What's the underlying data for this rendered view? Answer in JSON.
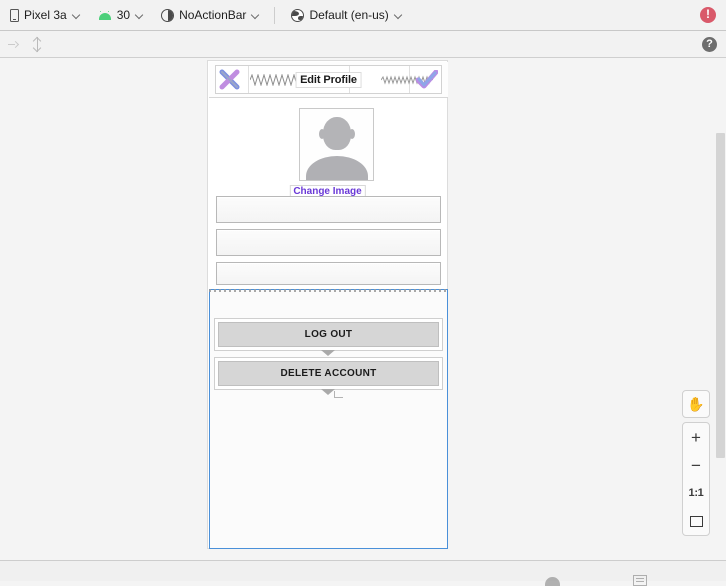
{
  "config_toolbar": {
    "device": {
      "icon": "phone-icon",
      "label": "Pixel 3a"
    },
    "api": {
      "icon": "android-icon",
      "label": "30"
    },
    "theme": {
      "icon": "theme-icon",
      "label": "NoActionBar"
    },
    "locale": {
      "icon": "globe-icon",
      "label": "Default (en-us)"
    },
    "error_badge": {
      "icon": "error-icon",
      "symbol": "!",
      "color": "#d9596a"
    }
  },
  "tool_toolbar": {
    "buttons": [
      {
        "icon": "arrow-right-icon",
        "enabled": false
      },
      {
        "icon": "vertical-resize-icon",
        "enabled": false
      }
    ],
    "help": {
      "icon": "help-icon",
      "symbol": "?"
    }
  },
  "preview": {
    "appbar": {
      "close_icon": "close-x-icon",
      "title": "Edit Profile",
      "confirm_icon": "checkmark-icon"
    },
    "avatar": {
      "icon": "person-placeholder-icon"
    },
    "change_image_link": "Change Image",
    "fields": [
      {
        "name": "field-one",
        "value": "",
        "placeholder": ""
      },
      {
        "name": "field-two",
        "value": "",
        "placeholder": ""
      },
      {
        "name": "field-three",
        "value": "",
        "placeholder": ""
      }
    ],
    "buttons": [
      {
        "label": "LOG OUT"
      },
      {
        "label": "DELETE ACCOUNT"
      }
    ],
    "selection_color": "#4a90d9",
    "link_color": "#6a39d7"
  },
  "zoom_controls": {
    "pan": {
      "icon": "hand-icon",
      "glyph": "✋"
    },
    "zoom_in": {
      "icon": "plus-icon",
      "glyph": "+"
    },
    "zoom_out": {
      "icon": "minus-icon",
      "glyph": "−"
    },
    "actual_size": {
      "icon": "one-to-one-icon",
      "label": "1:1"
    },
    "zoom_to_fit": {
      "icon": "zoom-to-fit-icon"
    }
  },
  "status_bar": {
    "icons": [
      {
        "icon": "android-icon"
      },
      {
        "icon": "list-icon"
      }
    ]
  }
}
